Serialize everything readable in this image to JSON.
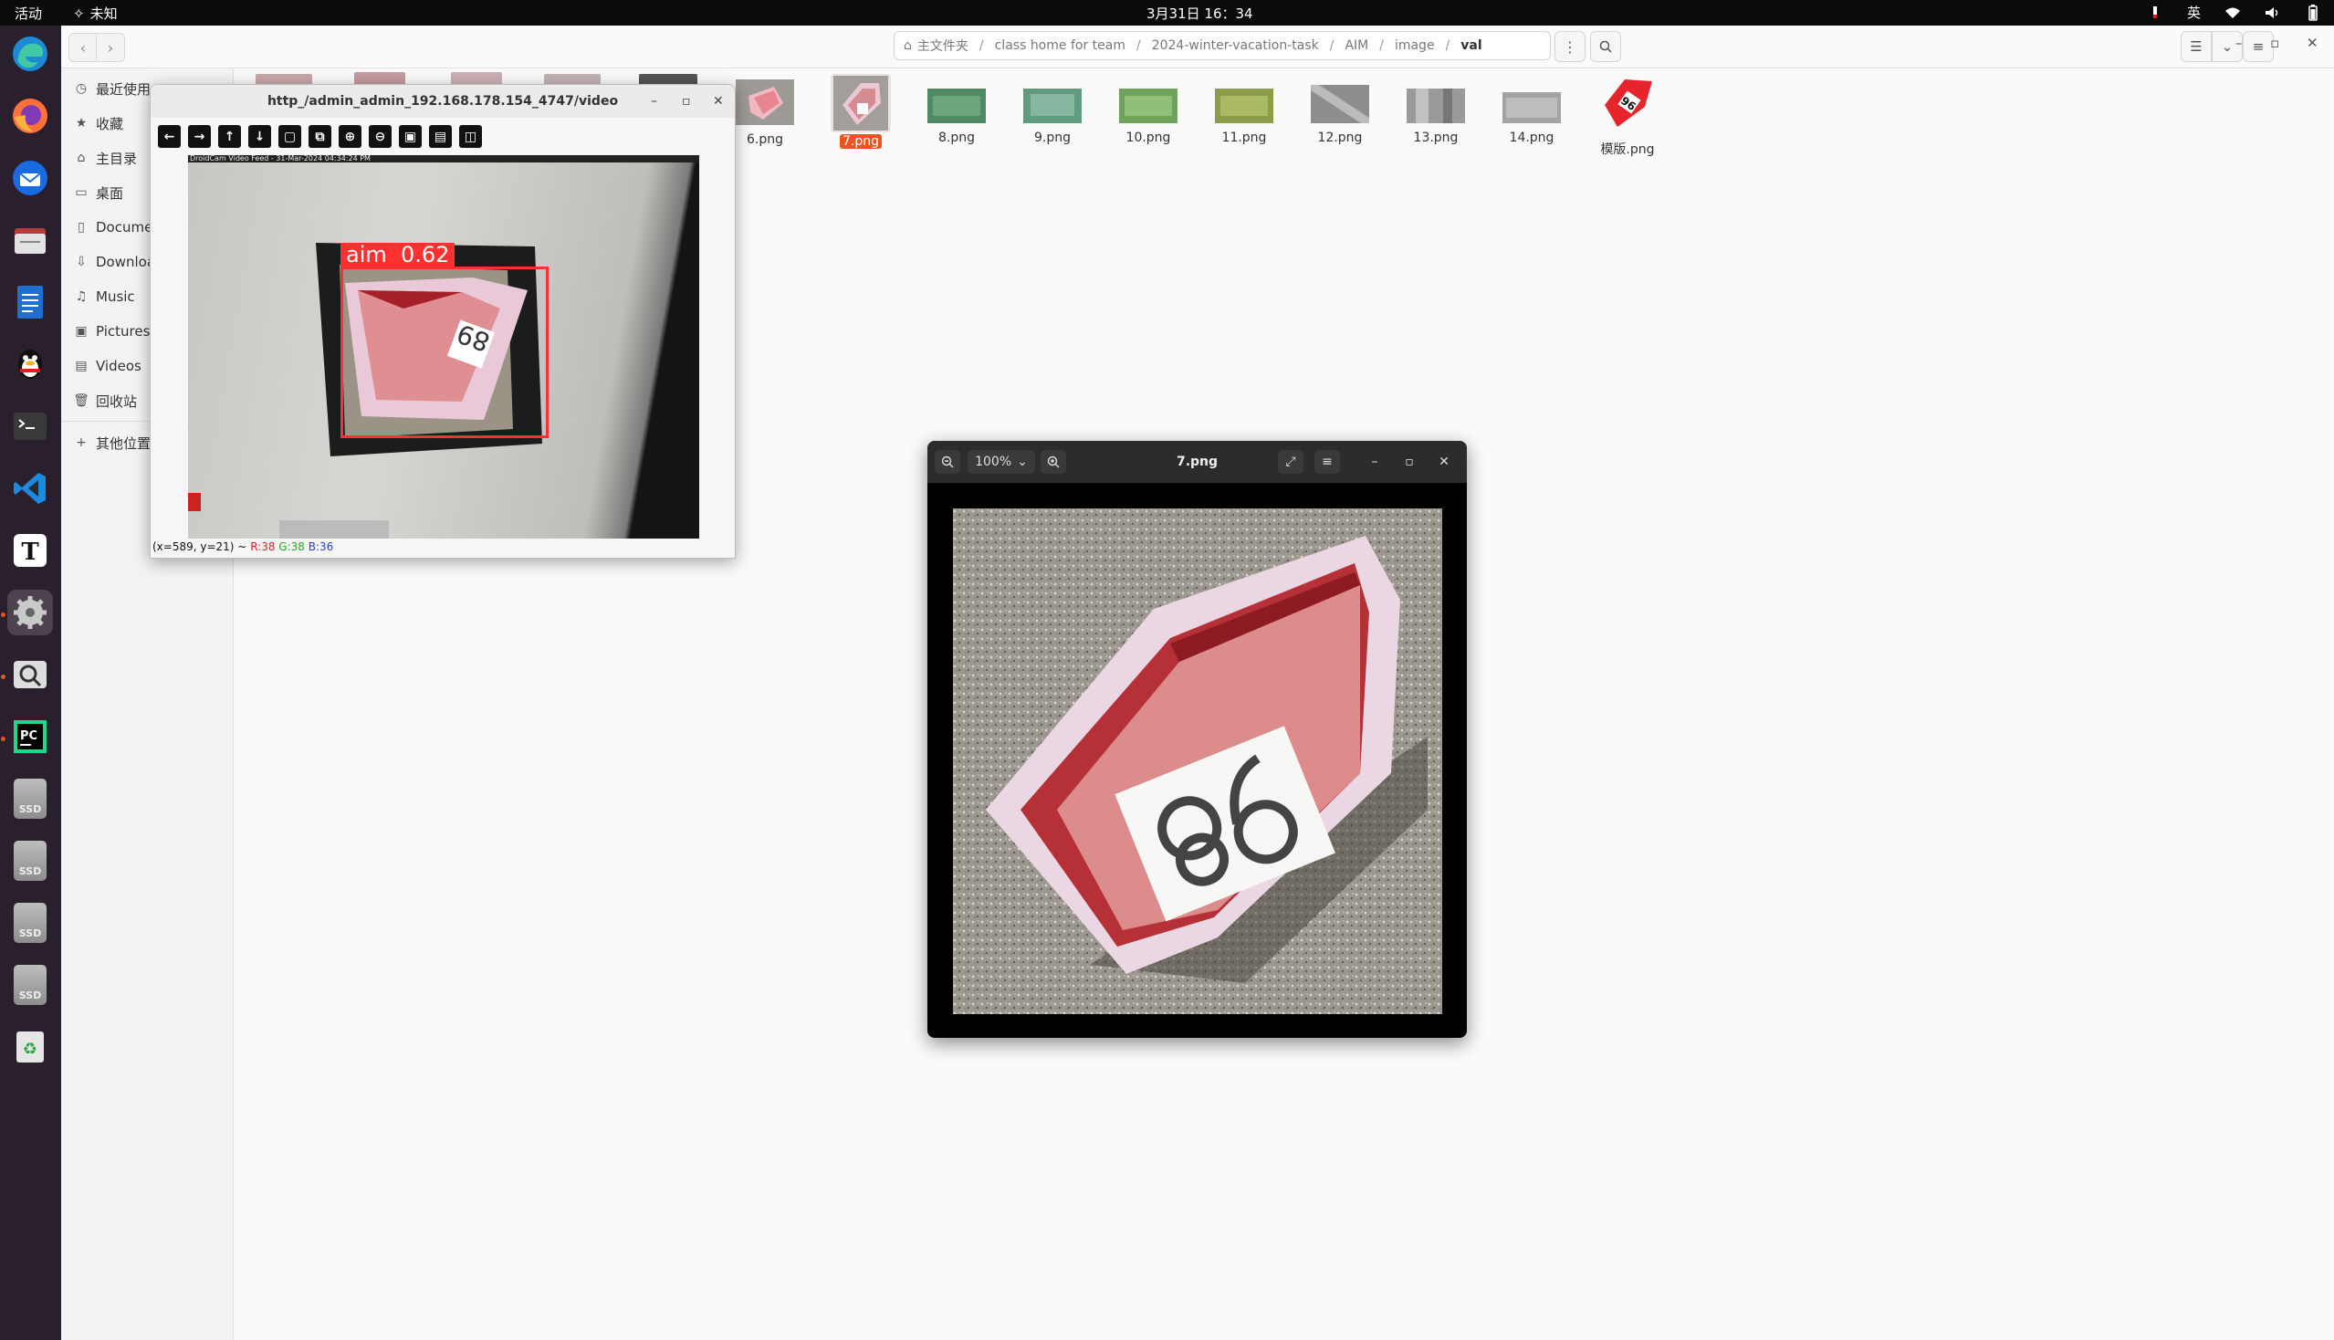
{
  "topbar": {
    "activities": "活动",
    "app_name": "未知",
    "clock": "3月31日 16：34",
    "input_method": "英"
  },
  "file_manager": {
    "path": [
      "主文件夹",
      "class home for team",
      "2024-winter-vacation-task",
      "AIM",
      "image",
      "val"
    ],
    "sidebar": [
      {
        "label": "最近使用",
        "icon": "clock-icon"
      },
      {
        "label": "收藏",
        "icon": "star-icon"
      },
      {
        "label": "主目录",
        "icon": "home-icon"
      },
      {
        "label": "桌面",
        "icon": "desktop-icon"
      },
      {
        "label": "Documents",
        "icon": "document-icon"
      },
      {
        "label": "Downloads",
        "icon": "download-icon"
      },
      {
        "label": "Music",
        "icon": "music-icon"
      },
      {
        "label": "Pictures",
        "icon": "picture-icon"
      },
      {
        "label": "Videos",
        "icon": "video-icon"
      },
      {
        "label": "回收站",
        "icon": "trash-icon"
      },
      {
        "label": "其他位置",
        "icon": "plus-icon"
      }
    ],
    "files": [
      "6.png",
      "7.png",
      "8.png",
      "9.png",
      "10.png",
      "11.png",
      "12.png",
      "13.png",
      "14.png",
      "模版.png"
    ],
    "selected_file": "7.png"
  },
  "video_window": {
    "title": "http_/admin_admin_192.168.178.154_4747/video",
    "overlay_header": "DroidCam Video Feed - 31-Mar-2024 04:34:24 PM",
    "detection_label": "aim  0.62",
    "status": {
      "coords": "(x=589, y=21) ~",
      "r": "R:38",
      "g": "G:38",
      "b": "B:36"
    },
    "colors": {
      "box": "#ff3030",
      "r": "#e02020",
      "g": "#20b020",
      "b": "#2040e0"
    }
  },
  "image_viewer": {
    "zoom": "100%",
    "title": "7.png"
  },
  "icons": {
    "dock": [
      "edge-icon",
      "firefox-icon",
      "thunderbird-icon",
      "files-icon",
      "writer-icon",
      "qq-icon",
      "terminal-icon",
      "vscode-icon",
      "typora-icon",
      "settings-icon",
      "search-icon",
      "pycharm-icon",
      "ssd-icon",
      "ssd-icon",
      "ssd-icon",
      "ssd-icon",
      "trash-icon"
    ]
  }
}
